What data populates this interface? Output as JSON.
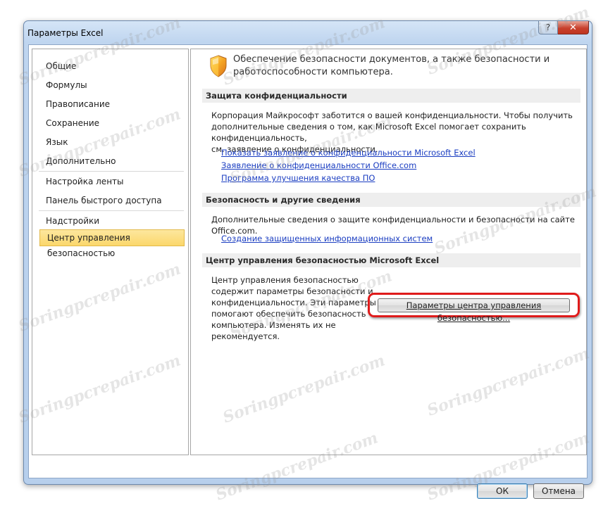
{
  "window": {
    "title": "Параметры Excel",
    "help_glyph": "?",
    "close_glyph": "✕"
  },
  "sidebar": {
    "items": [
      {
        "label": "Общие"
      },
      {
        "label": "Формулы"
      },
      {
        "label": "Правописание"
      },
      {
        "label": "Сохранение"
      },
      {
        "label": "Язык"
      },
      {
        "label": "Дополнительно"
      },
      {
        "label": "Настройка ленты"
      },
      {
        "label": "Панель быстрого доступа"
      },
      {
        "label": "Надстройки"
      },
      {
        "label": "Центр управления безопасностью"
      }
    ],
    "selected": "Центр управления безопасностью"
  },
  "header": {
    "icon": "shield-icon",
    "text": "Обеспечение безопасности документов, а также безопасности и работоспособности компьютера."
  },
  "privacy": {
    "title": "Защита конфиденциальности",
    "lines": [
      "Корпорация Майкрософт заботится о вашей конфиденциальности. Чтобы получить",
      "дополнительные сведения о том, как Microsoft Excel помогает сохранить конфиденциальность,",
      "см. заявление о конфиденциальности."
    ],
    "links": [
      "Показать заявление о конфиденциальности Microsoft Excel",
      "Заявление о конфиденциальности Office.com",
      "Программа улучшения качества ПО"
    ]
  },
  "security": {
    "title": "Безопасность и другие сведения",
    "text": "Дополнительные сведения о защите конфиденциальности и безопасности на сайте Office.com.",
    "link": "Создание защищенных информационных систем"
  },
  "trust_center": {
    "title": "Центр управления безопасностью Microsoft Excel",
    "lines": [
      "Центр управления безопасностью",
      "содержит параметры безопасности и",
      "конфиденциальности. Эти параметры",
      "помогают обеспечить безопасность",
      "компьютера. Изменять их не",
      "рекомендуется."
    ],
    "button_label": "Параметры центра управления безопасностью..."
  },
  "footer": {
    "ok_label": "ОК",
    "cancel_label": "Отмена"
  },
  "watermark": "Soringpcrepair.com",
  "colors": {
    "link": "#1a3dc1",
    "highlight": "#e01b1b",
    "selected_nav": "#fbd76b"
  }
}
